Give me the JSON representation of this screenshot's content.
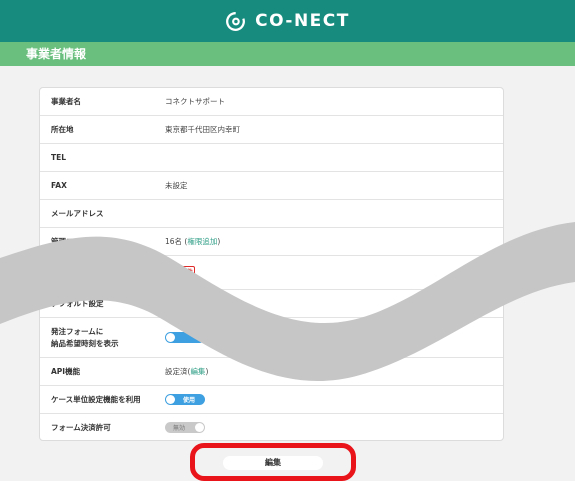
{
  "header": {
    "brand": "CO-NECT"
  },
  "section": {
    "title": "事業者情報"
  },
  "rows": {
    "company_name": {
      "label": "事業者名",
      "value": "コネクトサポート"
    },
    "address": {
      "label": "所在地",
      "value": "東京都千代田区内幸町"
    },
    "tel": {
      "label": "TEL",
      "value": ""
    },
    "fax": {
      "label": "FAX",
      "value": "未設定"
    },
    "email": {
      "label": "メールアドレス",
      "value": ""
    },
    "users": {
      "label": "管理ユーザ数",
      "value": "16名 (",
      "link": "権限追加",
      "suffix": ")"
    },
    "badge": {
      "text": "一括 件"
    },
    "default_setting": {
      "label": "デフォルト設定"
    },
    "order_form": {
      "label_line1": "発注フォームに",
      "label_line2": "納品希望時刻を表示"
    },
    "api": {
      "label": "API機能",
      "value": "設定済(",
      "link": "編集",
      "suffix": ")"
    },
    "case_unit": {
      "label": "ケース単位設定機能を利用",
      "toggle": "使用",
      "state": "on"
    },
    "form_payment": {
      "label": "フォーム決済許可",
      "toggle": "無効",
      "state": "off"
    }
  },
  "actions": {
    "edit_label": "編集"
  },
  "colors": {
    "header": "#178c7e",
    "section": "#6abf7e",
    "toggle_on": "#3ea0e0",
    "highlight": "#e8141a",
    "link": "#2e9e86"
  }
}
